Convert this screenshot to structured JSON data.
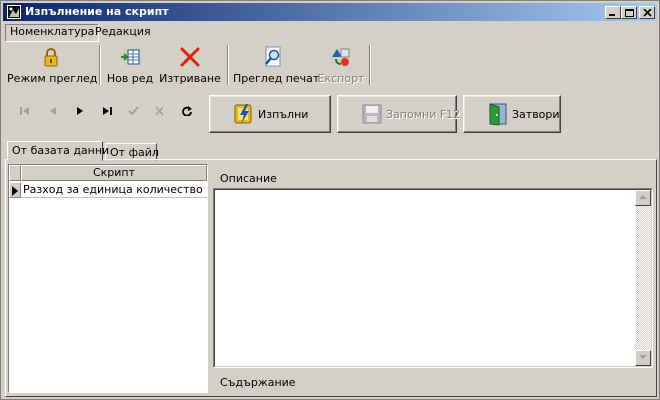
{
  "window": {
    "title": "Изпълнение на скрипт",
    "controls": {
      "minimize": "minimize-icon",
      "maximize": "maximize-icon",
      "close": "close-icon"
    }
  },
  "menu": {
    "items": [
      {
        "label": "Номенклатура",
        "active": true
      },
      {
        "label": "Редакция",
        "active": false
      }
    ]
  },
  "toolbar": {
    "buttons": [
      {
        "label": "Режим преглед",
        "icon": "lock-icon",
        "enabled": true
      },
      {
        "label": "Нов ред",
        "icon": "new-row-icon",
        "enabled": true
      },
      {
        "label": "Изтриване",
        "icon": "delete-icon",
        "enabled": true
      },
      {
        "label": "Преглед печат",
        "icon": "print-preview-icon",
        "enabled": true
      },
      {
        "label": "Експорт",
        "icon": "export-icon",
        "enabled": false
      }
    ]
  },
  "navigator": {
    "buttons": [
      {
        "icon": "first-record-icon",
        "enabled": false
      },
      {
        "icon": "prior-record-icon",
        "enabled": false
      },
      {
        "icon": "next-record-icon",
        "enabled": true
      },
      {
        "icon": "last-record-icon",
        "enabled": true
      },
      {
        "icon": "post-icon",
        "enabled": false
      },
      {
        "icon": "cancel-icon",
        "enabled": false
      },
      {
        "icon": "refresh-icon",
        "enabled": true
      }
    ]
  },
  "actions": {
    "execute": {
      "label": "Изпълни",
      "icon": "execute-icon",
      "enabled": true
    },
    "save": {
      "label": "Запомни  F12",
      "icon": "save-icon",
      "enabled": false
    },
    "close": {
      "label": "Затвори",
      "icon": "door-icon",
      "enabled": true
    }
  },
  "tabs": [
    {
      "label": "От базата данни",
      "active": true
    },
    {
      "label": "От файл",
      "active": false
    }
  ],
  "grid": {
    "column": "Скрипт",
    "rows": [
      "Разход за единица количество"
    ]
  },
  "description": {
    "label": "Описание",
    "value": ""
  },
  "content": {
    "label": "Съдържание"
  },
  "colors": {
    "titlebar_start": "#0a246a",
    "titlebar_end": "#a6caf0",
    "face": "#d4d0c8"
  }
}
